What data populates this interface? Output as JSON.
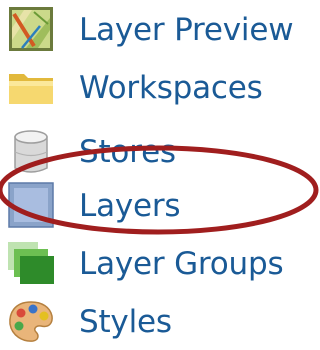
{
  "menu": {
    "items": [
      {
        "label": "Layer Preview",
        "icon": "layer-preview-map-icon"
      },
      {
        "label": "Workspaces",
        "icon": "folder-icon"
      },
      {
        "label": "Stores",
        "icon": "database-cylinder-icon"
      },
      {
        "label": "Layers",
        "icon": "layer-square-icon"
      },
      {
        "label": "Layer Groups",
        "icon": "layer-groups-icon"
      },
      {
        "label": "Styles",
        "icon": "palette-icon"
      }
    ],
    "highlighted_item": "Layers",
    "highlight_color": "#a01e1e",
    "link_color": "#1a5a96"
  }
}
